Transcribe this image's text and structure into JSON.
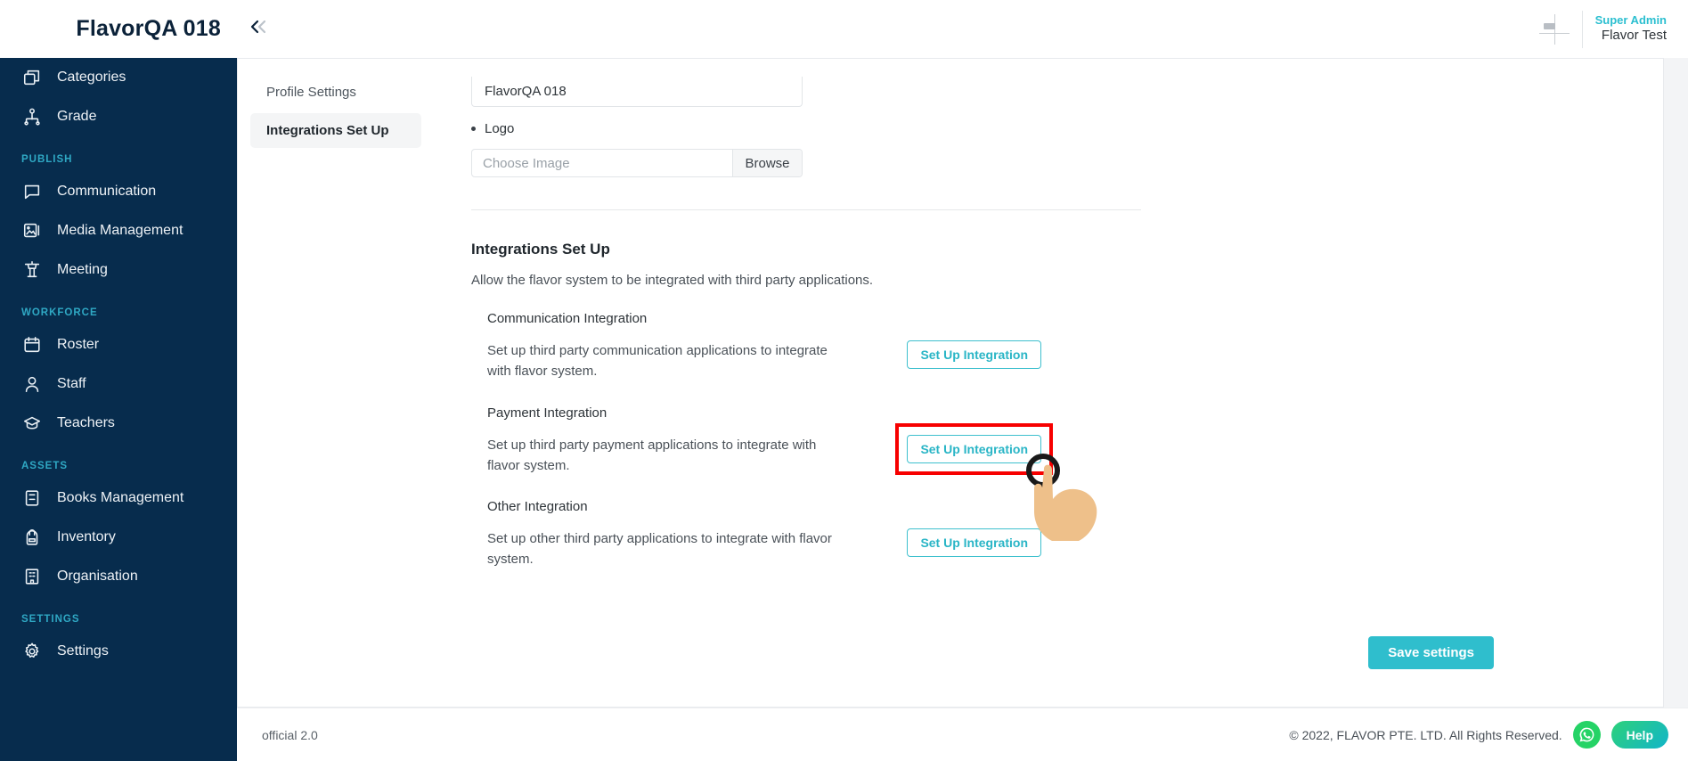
{
  "header": {
    "brand_title": "FlavorQA 018",
    "collapse_icon": "chevron-double-left-icon",
    "user_role": "Super Admin",
    "user_name": "Flavor Test",
    "avatar_icon": "broken-image-avatar-icon"
  },
  "sidebar": {
    "items": [
      {
        "type": "item",
        "label": "Categories",
        "icon": "layers-icon"
      },
      {
        "type": "item",
        "label": "Grade",
        "icon": "hierarchy-icon"
      },
      {
        "type": "section",
        "label": "PUBLISH"
      },
      {
        "type": "item",
        "label": "Communication",
        "icon": "chat-bubble-icon"
      },
      {
        "type": "item",
        "label": "Media Management",
        "icon": "image-icon"
      },
      {
        "type": "item",
        "label": "Meeting",
        "icon": "podium-icon"
      },
      {
        "type": "section",
        "label": "WORKFORCE"
      },
      {
        "type": "item",
        "label": "Roster",
        "icon": "calendar-icon"
      },
      {
        "type": "item",
        "label": "Staff",
        "icon": "person-icon"
      },
      {
        "type": "item",
        "label": "Teachers",
        "icon": "graduation-cap-icon"
      },
      {
        "type": "section",
        "label": "ASSETS"
      },
      {
        "type": "item",
        "label": "Books Management",
        "icon": "book-icon"
      },
      {
        "type": "item",
        "label": "Inventory",
        "icon": "backpack-icon"
      },
      {
        "type": "item",
        "label": "Organisation",
        "icon": "building-icon"
      },
      {
        "type": "section",
        "label": "SETTINGS"
      },
      {
        "type": "item",
        "label": "Settings",
        "icon": "gear-icon"
      }
    ]
  },
  "subnav": {
    "items": [
      {
        "label": "Profile Settings",
        "active": false
      },
      {
        "label": "Integrations Set Up",
        "active": true
      }
    ]
  },
  "form": {
    "name_value": "FlavorQA 018",
    "logo_label": "Logo",
    "file_placeholder": "Choose Image",
    "browse_label": "Browse"
  },
  "integrations": {
    "title": "Integrations Set Up",
    "description": "Allow the flavor system to be integrated with third party applications.",
    "blocks": [
      {
        "name": "Communication Integration",
        "description": "Set up third party communication applications to integrate with flavor system.",
        "button_label": "Set Up Integration",
        "highlighted": false
      },
      {
        "name": "Payment Integration",
        "description": "Set up third party payment applications to integrate with flavor system.",
        "button_label": "Set Up Integration",
        "highlighted": true
      },
      {
        "name": "Other Integration",
        "description": "Set up other third party applications to integrate with flavor system.",
        "button_label": "Set Up Integration",
        "highlighted": false
      }
    ],
    "save_label": "Save settings"
  },
  "footer": {
    "version": "official 2.0",
    "copyright": "© 2022, FLAVOR PTE. LTD. All Rights Reserved.",
    "whatsapp_icon": "whatsapp-icon",
    "help_label": "Help"
  },
  "colors": {
    "sidebar_bg": "#072c4d",
    "accent_teal": "#2fbecd",
    "section_label": "#2fa8c4",
    "highlight_red": "#f70000",
    "whatsapp_green": "#25d366"
  }
}
